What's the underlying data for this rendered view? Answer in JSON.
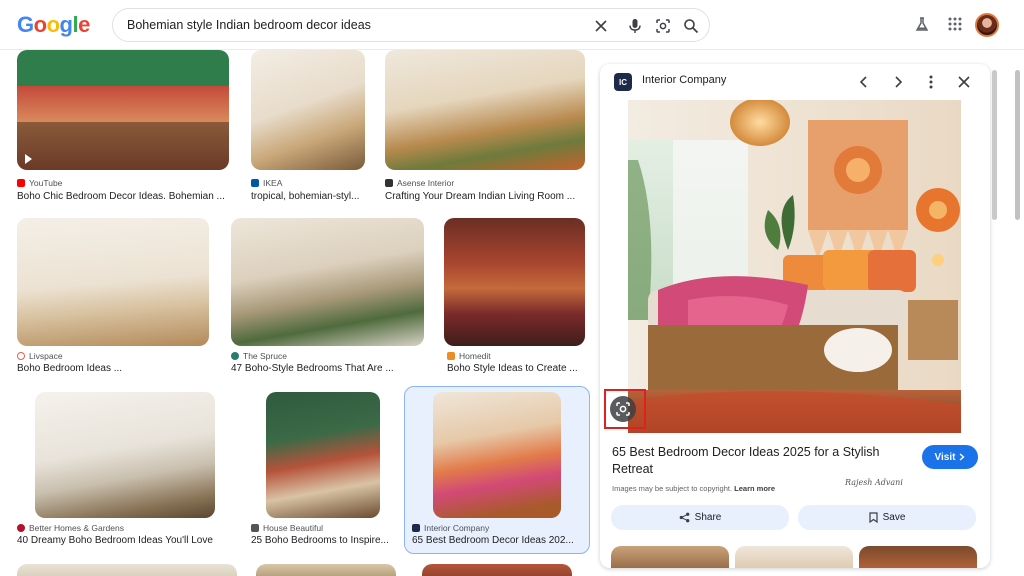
{
  "header": {
    "logo_letters": [
      "G",
      "o",
      "o",
      "g",
      "l",
      "e"
    ],
    "logo_colors": [
      "#4285F4",
      "#EA4335",
      "#FBBC05",
      "#4285F4",
      "#34A853",
      "#EA4335"
    ],
    "search_query": "Bohemian style Indian bedroom decor ideas",
    "icons": [
      "clear-icon",
      "microphone-icon",
      "lens-icon",
      "search-icon",
      "labs-icon",
      "apps-grid-icon"
    ]
  },
  "results": [
    {
      "source": "YouTube",
      "title": "Boho Chic Bedroom Decor Ideas. Bohemian ...",
      "fav_color": "#ff0000"
    },
    {
      "source": "IKEA",
      "title": "tropical, bohemian-styl...",
      "fav_color": "#0058a3"
    },
    {
      "source": "Asense Interior",
      "title": "Crafting Your Dream Indian Living Room ...",
      "fav_color": "#333333"
    },
    {
      "source": "Livspace",
      "title": "Boho Bedroom Ideas ...",
      "fav_color": "#e8604c"
    },
    {
      "source": "The Spruce",
      "title": "47 Boho-Style Bedrooms That Are ...",
      "fav_color": "#2a7a6f"
    },
    {
      "source": "Homedit",
      "title": "Boho Style Ideas to Create ...",
      "fav_color": "#f08a24"
    },
    {
      "source": "Better Homes & Gardens",
      "title": "40 Dreamy Boho Bedroom Ideas You'll Love",
      "fav_color": "#b5122b"
    },
    {
      "source": "House Beautiful",
      "title": "25 Boho Bedrooms to Inspire...",
      "fav_color": "#555555"
    },
    {
      "source": "Interior Company",
      "title": "65 Best Bedroom Decor Ideas 202...",
      "fav_color": "#1e2a4a"
    }
  ],
  "panel": {
    "logo_text": "IC",
    "source": "Interior Company",
    "title": "65 Best Bedroom Decor Ideas 2025 for a Stylish Retreat",
    "visit_label": "Visit",
    "copyright_text": "Images may be subject to copyright.",
    "learn_more": "Learn more",
    "signature": "Rajesh Advani",
    "share_label": "Share",
    "save_label": "Save"
  }
}
